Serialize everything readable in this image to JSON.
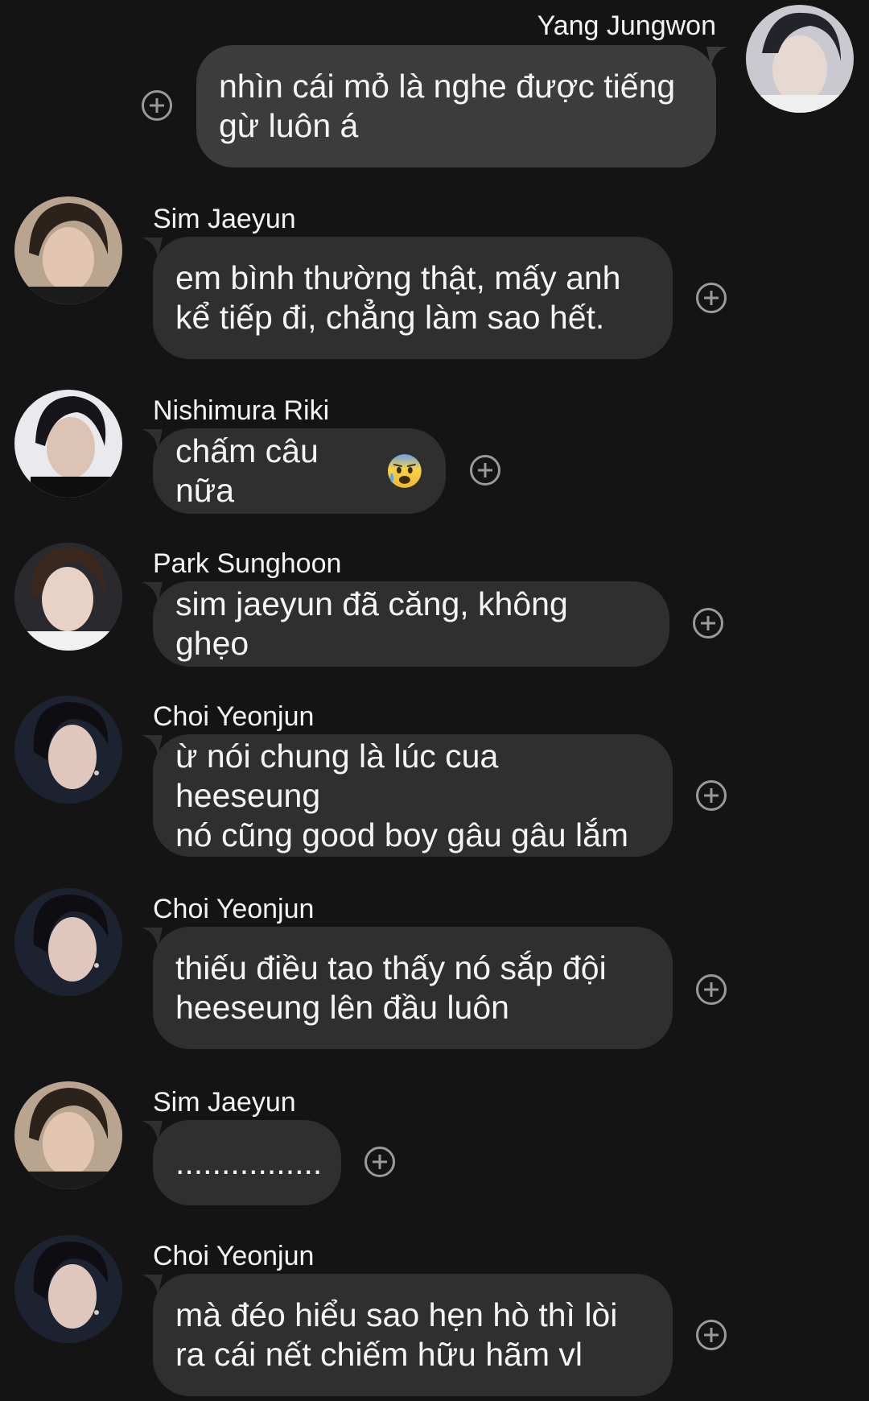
{
  "messages": [
    {
      "sender": "Yang Jungwon",
      "text": "nhìn cái mỏ là nghe được tiếng\ngừ luôn á",
      "outgoing": true,
      "avatar": "avatar-yang-jungwon"
    },
    {
      "sender": "Sim Jaeyun",
      "text": "em bình thường thật, mấy anh\nkể tiếp đi, chẳng làm sao hết.",
      "outgoing": false,
      "avatar": "avatar-sim-jaeyun"
    },
    {
      "sender": "Nishimura Riki",
      "text": "chấm câu nữa",
      "emoji": "anxious-face-with-sweat-emoji",
      "outgoing": false,
      "avatar": "avatar-nishimura-riki"
    },
    {
      "sender": "Park Sunghoon",
      "text": "sim jaeyun đã căng, không ghẹo",
      "outgoing": false,
      "avatar": "avatar-park-sunghoon"
    },
    {
      "sender": "Choi Yeonjun",
      "text": "ừ nói chung là lúc cua heeseung\nnó cũng good boy gâu gâu lắm",
      "outgoing": false,
      "avatar": "avatar-choi-yeonjun"
    },
    {
      "sender": "Choi Yeonjun",
      "text": "thiếu điều tao thấy nó sắp đội\nheeseung lên đầu luôn",
      "outgoing": false,
      "avatar": "avatar-choi-yeonjun"
    },
    {
      "sender": "Sim Jaeyun",
      "text": "................",
      "outgoing": false,
      "avatar": "avatar-sim-jaeyun"
    },
    {
      "sender": "Choi Yeonjun",
      "text": "mà đéo hiểu sao hẹn hò thì lòi\nra cái nết chiếm hữu hãm vl",
      "outgoing": false,
      "avatar": "avatar-choi-yeonjun"
    }
  ],
  "theme": {
    "background": "#141414",
    "bubble_incoming": "#2f2f2f",
    "bubble_outgoing": "#3c3c3c",
    "text": "#f5f5f5",
    "react_icon": "#9a9a9a"
  },
  "icons": {
    "react": "add-reaction-icon"
  }
}
